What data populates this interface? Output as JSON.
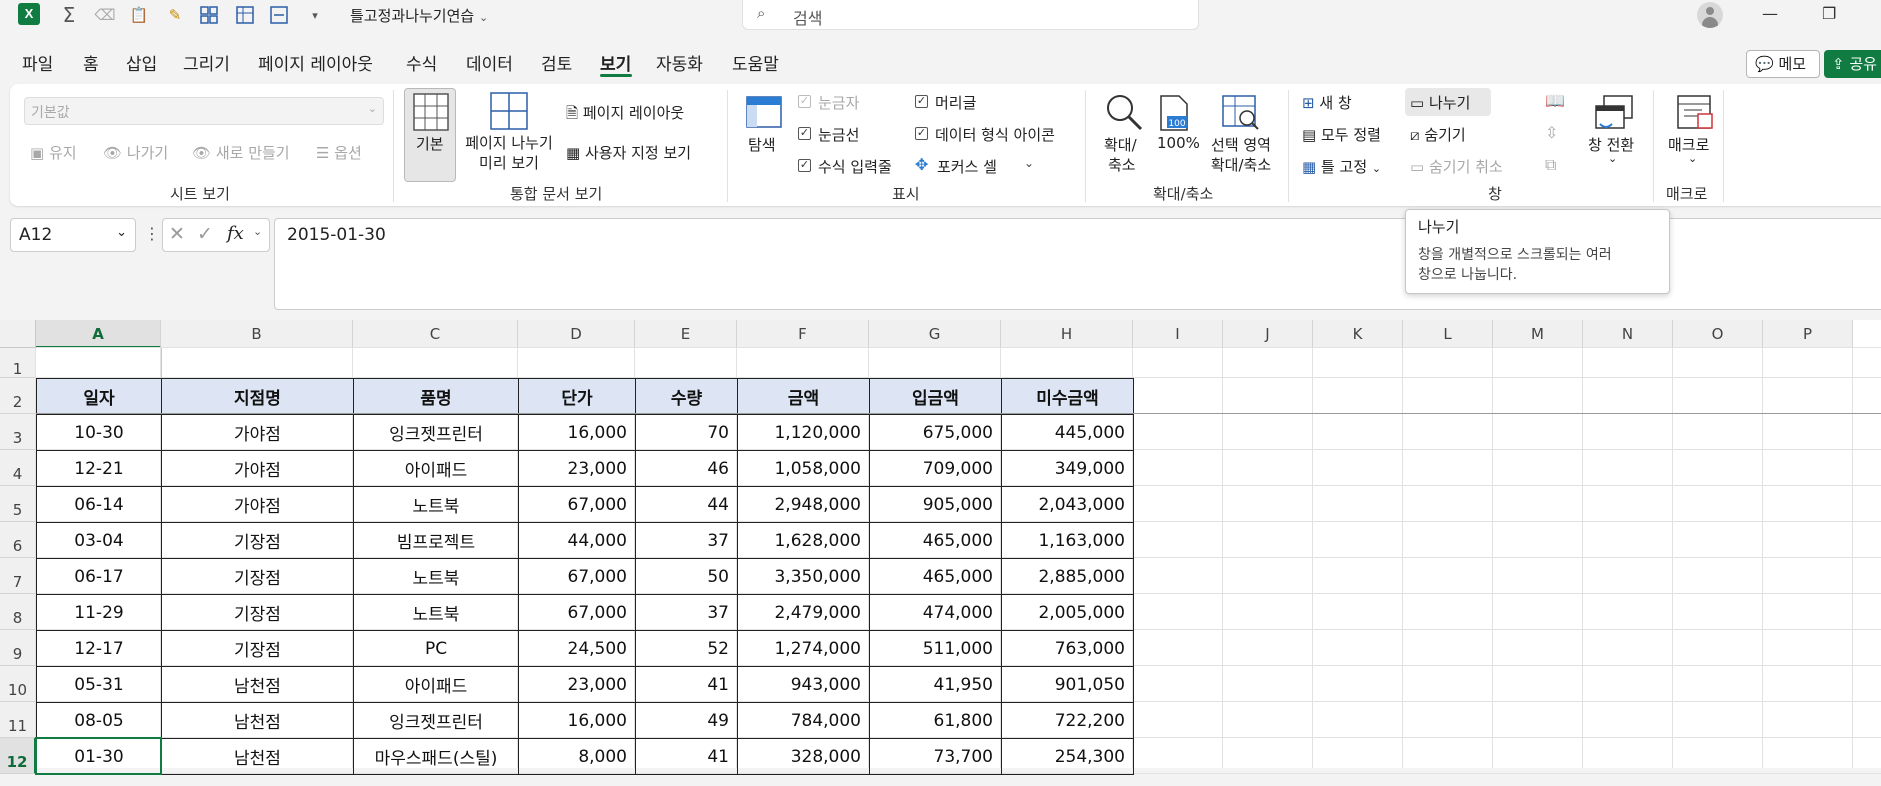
{
  "titlebar": {
    "filename": "틀고정과나누기연습",
    "search_placeholder": "검색",
    "excel_icon": "excel-icon",
    "quick_access_icons": [
      "autosum-icon",
      "clear-icon",
      "paste-icon",
      "number-format-icon",
      "format-painter-icon",
      "freeze-icon",
      "grid-icon",
      "fit-icon",
      "dropdown-icon"
    ]
  },
  "menu": {
    "tabs": [
      "파일",
      "홈",
      "삽입",
      "그리기",
      "페이지 레이아웃",
      "수식",
      "데이터",
      "검토",
      "보기",
      "자동화",
      "도움말"
    ],
    "active": "보기",
    "memo_button": "메모",
    "share_button": "공유"
  },
  "ribbon": {
    "sheet_view": {
      "dropdown_value": "기본값",
      "keep": "유지",
      "exit": "나가기",
      "new": "새로 만들기",
      "options": "옵션",
      "label": "시트 보기"
    },
    "workbook_views": {
      "normal": "기본",
      "page_break_line1": "페이지 나누기",
      "page_break_line2": "미리 보기",
      "page_layout": "페이지 레이아웃",
      "custom_views": "사용자 지정 보기",
      "label": "통합 문서 보기"
    },
    "show": {
      "navigation": "탐색",
      "ruler": "눈금자",
      "gridlines": "눈금선",
      "formula_bar": "수식 입력줄",
      "headings": "머리글",
      "data_type_icons": "데이터 형식 아이콘",
      "focus_cell": "포커스 셀",
      "label": "표시"
    },
    "zoom": {
      "zoom_line1": "확대/",
      "zoom_line2": "축소",
      "hundred": "100%",
      "selection_line1": "선택 영역",
      "selection_line2": "확대/축소",
      "label": "확대/축소"
    },
    "window": {
      "new_window": "새 창",
      "arrange_all": "모두 정렬",
      "freeze_panes": "틀 고정",
      "split": "나누기",
      "hide": "숨기기",
      "unhide": "숨기기 취소",
      "switch_line1": "창 전환",
      "label": "창"
    },
    "macros": {
      "macros": "매크로",
      "label": "매크로"
    }
  },
  "formula_bar": {
    "name_box": "A12",
    "fx": "fx",
    "value": "2015-01-30"
  },
  "tooltip": {
    "title": "나누기",
    "body_line1": "창을 개별적으로 스크롤되는 여러",
    "body_line2": "창으로 나눕니다."
  },
  "sheet": {
    "columns": [
      "A",
      "B",
      "C",
      "D",
      "E",
      "F",
      "G",
      "H",
      "I",
      "J",
      "K",
      "L",
      "M",
      "N",
      "O",
      "P"
    ],
    "rows": [
      "1",
      "2",
      "3",
      "4",
      "5",
      "6",
      "7",
      "8",
      "9",
      "10",
      "11",
      "12"
    ],
    "table_headers": [
      "일자",
      "지점명",
      "품명",
      "단가",
      "수량",
      "금액",
      "입금액",
      "미수금액"
    ],
    "table_rows": [
      [
        "10-30",
        "가야점",
        "잉크젯프린터",
        "16,000",
        "70",
        "1,120,000",
        "675,000",
        "445,000"
      ],
      [
        "12-21",
        "가야점",
        "아이패드",
        "23,000",
        "46",
        "1,058,000",
        "709,000",
        "349,000"
      ],
      [
        "06-14",
        "가야점",
        "노트북",
        "67,000",
        "44",
        "2,948,000",
        "905,000",
        "2,043,000"
      ],
      [
        "03-04",
        "기장점",
        "빔프로젝트",
        "44,000",
        "37",
        "1,628,000",
        "465,000",
        "1,163,000"
      ],
      [
        "06-17",
        "기장점",
        "노트북",
        "67,000",
        "50",
        "3,350,000",
        "465,000",
        "2,885,000"
      ],
      [
        "11-29",
        "기장점",
        "노트북",
        "67,000",
        "37",
        "2,479,000",
        "474,000",
        "2,005,000"
      ],
      [
        "12-17",
        "기장점",
        "PC",
        "24,500",
        "52",
        "1,274,000",
        "511,000",
        "763,000"
      ],
      [
        "05-31",
        "남천점",
        "아이패드",
        "23,000",
        "41",
        "943,000",
        "41,950",
        "901,050"
      ],
      [
        "08-05",
        "남천점",
        "잉크젯프린터",
        "16,000",
        "49",
        "784,000",
        "61,800",
        "722,200"
      ],
      [
        "01-30",
        "남천점",
        "마우스패드(스틸)",
        "8,000",
        "41",
        "328,000",
        "73,700",
        "254,300"
      ]
    ],
    "active_cell": "A12",
    "header_fill": "#dde5f4",
    "accent": "#107c41"
  }
}
